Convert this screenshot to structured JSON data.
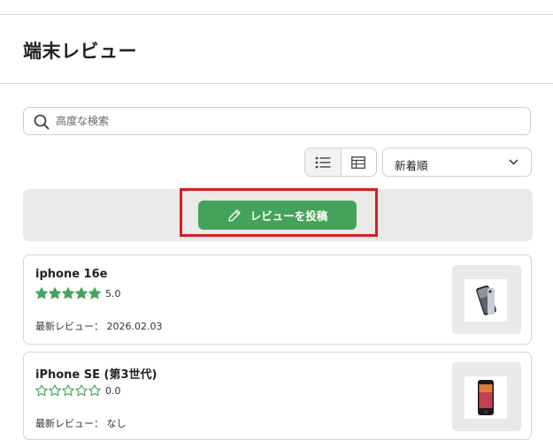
{
  "header": {
    "title": "端末レビュー"
  },
  "search": {
    "placeholder": "高度な検索",
    "value": ""
  },
  "view": {
    "active": "list"
  },
  "sort": {
    "selected": "新着順"
  },
  "post": {
    "label": "レビューを投稿"
  },
  "colors": {
    "accent": "#44a35a",
    "star": "#44a35a",
    "highlight": "#d61d25"
  },
  "reviews": [
    {
      "name": "iphone 16e",
      "rating": "5.0",
      "stars_filled": 5,
      "latest": "最新レビュー： 2026.02.03"
    },
    {
      "name": "iPhone SE (第3世代)",
      "rating": "0.0",
      "stars_filled": 0,
      "latest": "最新レビュー： なし"
    }
  ]
}
